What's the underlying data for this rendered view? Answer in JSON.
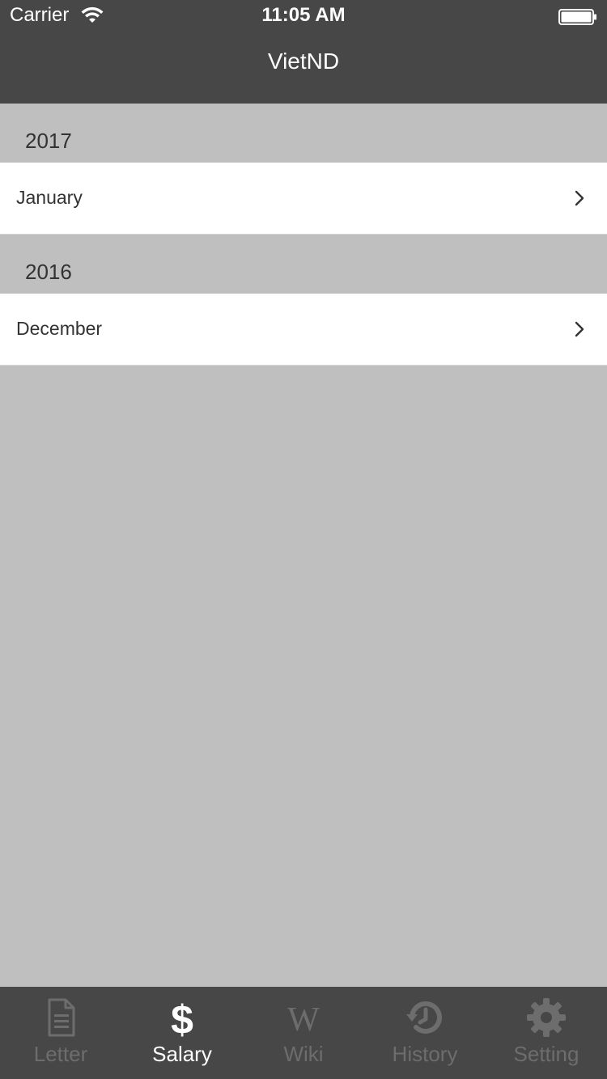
{
  "status_bar": {
    "carrier": "Carrier",
    "time": "11:05 AM",
    "icons": [
      "wifi-icon",
      "battery-icon"
    ]
  },
  "nav": {
    "title": "VietND"
  },
  "sections": [
    {
      "header": "2017",
      "rows": [
        {
          "label": "January",
          "icon": "chevron-right-icon"
        }
      ]
    },
    {
      "header": "2016",
      "rows": [
        {
          "label": "December",
          "icon": "chevron-right-icon"
        }
      ]
    }
  ],
  "tab_bar": {
    "items": [
      {
        "label": "Letter",
        "icon": "document-icon",
        "active": false
      },
      {
        "label": "Salary",
        "icon": "dollar-icon",
        "active": true
      },
      {
        "label": "Wiki",
        "icon": "wiki-icon",
        "active": false
      },
      {
        "label": "History",
        "icon": "history-icon",
        "active": false
      },
      {
        "label": "Setting",
        "icon": "gear-icon",
        "active": false
      }
    ]
  },
  "colors": {
    "bar_background": "#474747",
    "content_background": "#bfbfbf",
    "row_background": "#ffffff",
    "tab_inactive": "#6d6d6d",
    "tab_active": "#ffffff"
  }
}
